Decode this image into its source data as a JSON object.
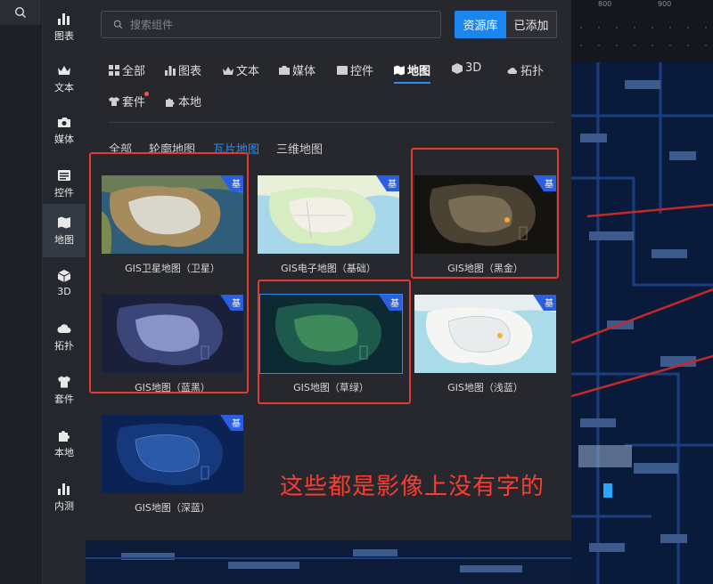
{
  "search": {
    "placeholder": "搜索组件"
  },
  "header": {
    "library_tab": "资源库",
    "added_tab": "已添加"
  },
  "categories": [
    {
      "name": "chart",
      "label": "图表"
    },
    {
      "name": "text",
      "label": "文本"
    },
    {
      "name": "media",
      "label": "媒体"
    },
    {
      "name": "control",
      "label": "控件"
    },
    {
      "name": "map",
      "label": "地图",
      "active": true
    },
    {
      "name": "3d",
      "label": "3D"
    },
    {
      "name": "topology",
      "label": "拓扑"
    },
    {
      "name": "kit",
      "label": "套件"
    },
    {
      "name": "local",
      "label": "本地"
    },
    {
      "name": "beta",
      "label": "内测"
    }
  ],
  "type_tabs": [
    {
      "label": "全部"
    },
    {
      "label": "图表"
    },
    {
      "label": "文本"
    },
    {
      "label": "媒体"
    },
    {
      "label": "控件"
    },
    {
      "label": "地图",
      "active": true
    },
    {
      "label": "3D"
    },
    {
      "label": "拓扑"
    },
    {
      "label": "套件",
      "has_dot": true
    },
    {
      "label": "本地"
    }
  ],
  "sub_tabs": [
    {
      "label": "全部"
    },
    {
      "label": "轮廓地图"
    },
    {
      "label": "瓦片地图",
      "active": true
    },
    {
      "label": "三维地图"
    }
  ],
  "cards": [
    {
      "label": "GIS卫星地图（卫星）",
      "badge": "基"
    },
    {
      "label": "GIS电子地图（基础）",
      "badge": "基"
    },
    {
      "label": "GIS地图（黑金）",
      "badge": "基"
    },
    {
      "label": "GIS地图（蓝黑）",
      "badge": "基"
    },
    {
      "label": "GIS地图（草绿）",
      "badge": "基"
    },
    {
      "label": "GIS地图（浅蓝）",
      "badge": "基"
    },
    {
      "label": "GIS地图（深蓝）",
      "badge": "基"
    }
  ],
  "annotation": {
    "text": "这些都是影像上没有字的"
  },
  "ruler": {
    "ticks": [
      "800",
      "900"
    ]
  },
  "colors": {
    "accent": "#1c86f0",
    "annotation": "#e53935",
    "panel_bg": "#26282e"
  }
}
